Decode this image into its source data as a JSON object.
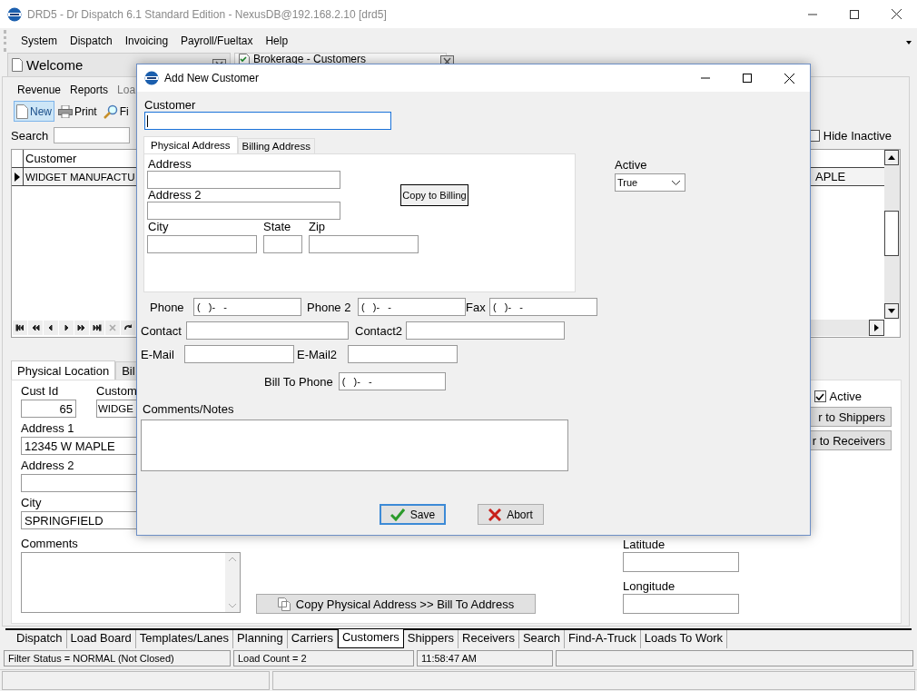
{
  "window": {
    "title": "DRD5 - Dr Dispatch 6.1 Standard Edition - NexusDB@192.168.2.10 [drd5]"
  },
  "menu": [
    "System",
    "Dispatch",
    "Invoicing",
    "Payroll/Fueltax",
    "Help"
  ],
  "doc_tabs": [
    {
      "label": "Welcome",
      "kind": "page",
      "selected": false
    },
    {
      "label": "Brokerage - Customers",
      "kind": "grid",
      "selected": true
    }
  ],
  "toolbar": [
    "Revenue",
    "Reports",
    "Loa"
  ],
  "actions": [
    {
      "label": "New",
      "kind": "new",
      "highlighted": true
    },
    {
      "label": "Print",
      "kind": "print",
      "highlighted": false
    },
    {
      "label": "Fi",
      "kind": "find",
      "highlighted": false
    }
  ],
  "search": {
    "label": "Search"
  },
  "hide_inactive": {
    "label": "Hide Inactive",
    "checked": false
  },
  "grid": {
    "columns": [
      "Customer"
    ],
    "rows": [
      {
        "cells": [
          "WIDGET MANUFACTU",
          "APLE"
        ],
        "selected": true
      }
    ]
  },
  "navigator": [
    {
      "kind": "first",
      "disabled": false
    },
    {
      "kind": "prior_page",
      "disabled": false
    },
    {
      "kind": "prior",
      "disabled": false
    },
    {
      "kind": "next",
      "disabled": false
    },
    {
      "kind": "next_page",
      "disabled": false
    },
    {
      "kind": "last",
      "disabled": false
    },
    {
      "kind": "delete",
      "disabled": true
    },
    {
      "kind": "refresh",
      "disabled": false
    }
  ],
  "detail_tabs": [
    {
      "label": "Physical Location",
      "selected": true
    },
    {
      "label": "Bil",
      "selected": false
    }
  ],
  "detail": {
    "cust_id": {
      "label": "Cust Id",
      "value": "65"
    },
    "customer": {
      "label": "Custom",
      "value": "WIDGE"
    },
    "address_1": {
      "label": "Address 1",
      "value": "12345 W MAPLE"
    },
    "address_2": {
      "label": "Address 2"
    },
    "city": {
      "label": "City",
      "value": "SPRINGFIELD"
    },
    "comments": {
      "label": "Comments"
    },
    "active": {
      "label": "Active",
      "checked": true
    },
    "buttons": [
      "r to Shippers",
      "r to Receivers"
    ],
    "latitude": {
      "label": "Latitude"
    },
    "longitude": {
      "label": "Longitude"
    },
    "copy_button": "Copy Physical Address >> Bill To Address"
  },
  "bottom_tabs": [
    {
      "label": "Dispatch",
      "selected": false
    },
    {
      "label": "Load Board",
      "selected": false
    },
    {
      "label": "Templates/Lanes",
      "selected": false
    },
    {
      "label": "Planning",
      "selected": false
    },
    {
      "label": "Carriers",
      "selected": false
    },
    {
      "label": "Customers",
      "selected": true
    },
    {
      "label": "Shippers",
      "selected": false
    },
    {
      "label": "Receivers",
      "selected": false
    },
    {
      "label": "Search",
      "selected": false
    },
    {
      "label": "Find-A-Truck",
      "selected": false
    },
    {
      "label": "Loads To Work",
      "selected": false
    }
  ],
  "status_bar": [
    "Filter Status = NORMAL (Not Closed)",
    "Load Count = 2",
    "11:58:47 AM"
  ],
  "dialog": {
    "title": "Add New Customer",
    "customer": {
      "label": "Customer",
      "focused": true
    },
    "tabs": [
      {
        "label": "Physical Address",
        "selected": true
      },
      {
        "label": "Billing Address",
        "selected": false
      }
    ],
    "address": {
      "label": "Address"
    },
    "address_2": {
      "label": "Address 2"
    },
    "city": {
      "label": "City"
    },
    "state": {
      "label": "State"
    },
    "zip": {
      "label": "Zip"
    },
    "copy_button": "Copy to Billing",
    "active": {
      "label": "Active",
      "value": "True"
    },
    "rows": [
      [
        {
          "label": "Phone",
          "value": "(   )-   -"
        },
        {
          "label": "Phone 2",
          "value": "(   )-   -"
        },
        {
          "label": "Fax",
          "value": "(   )-   -"
        }
      ],
      [
        {
          "label": "Contact"
        },
        {
          "label": "Contact2"
        }
      ],
      [
        {
          "label": "E-Mail"
        },
        {
          "label": "E-Mail2"
        }
      ]
    ],
    "bill_to_phone": {
      "label": "Bill To Phone",
      "value": "(   )-   -"
    },
    "comments": {
      "label": "Comments/Notes"
    },
    "buttons": [
      {
        "label": "Save",
        "kind": "save",
        "focused": true
      },
      {
        "label": "Abort",
        "kind": "abort",
        "focused": false
      }
    ]
  }
}
